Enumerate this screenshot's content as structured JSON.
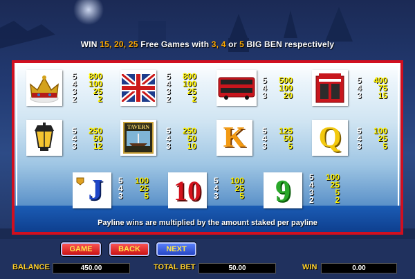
{
  "header": {
    "prefix": "WIN",
    "n1": "15,",
    "n2": "20,",
    "n3": "25",
    "mid": "Free Games with",
    "c1": "3,",
    "c2": "4",
    "or": "or",
    "c3": "5",
    "suffix_hl": "BIG BEN",
    "suffix": "respectively"
  },
  "symbols": [
    {
      "name": "crown",
      "icon": "crown-icon",
      "pays": [
        [
          "5",
          "800"
        ],
        [
          "4",
          "100"
        ],
        [
          "3",
          "25"
        ],
        [
          "2",
          "2"
        ]
      ]
    },
    {
      "name": "union-flag",
      "icon": "union-flag-icon",
      "pays": [
        [
          "5",
          "800"
        ],
        [
          "4",
          "100"
        ],
        [
          "3",
          "25"
        ],
        [
          "2",
          "2"
        ]
      ]
    },
    {
      "name": "bus",
      "icon": "double-decker-bus-icon",
      "pays": [
        [
          "5",
          "500"
        ],
        [
          "4",
          "100"
        ],
        [
          "3",
          "20"
        ]
      ]
    },
    {
      "name": "phone-booth",
      "icon": "telephone-box-icon",
      "pays": [
        [
          "5",
          "400"
        ],
        [
          "4",
          "75"
        ],
        [
          "3",
          "15"
        ]
      ]
    },
    {
      "name": "lamp",
      "icon": "street-lamp-icon",
      "pays": [
        [
          "5",
          "250"
        ],
        [
          "4",
          "50"
        ],
        [
          "3",
          "12"
        ]
      ]
    },
    {
      "name": "tavern",
      "icon": "tavern-sign-icon",
      "label": "TAVERN",
      "pays": [
        [
          "5",
          "250"
        ],
        [
          "4",
          "50"
        ],
        [
          "3",
          "10"
        ]
      ]
    },
    {
      "name": "king",
      "icon": "letter-k-icon",
      "label": "K",
      "pays": [
        [
          "5",
          "125"
        ],
        [
          "4",
          "50"
        ],
        [
          "3",
          "5"
        ]
      ]
    },
    {
      "name": "queen",
      "icon": "letter-q-icon",
      "label": "Q",
      "pays": [
        [
          "5",
          "100"
        ],
        [
          "4",
          "25"
        ],
        [
          "3",
          "5"
        ]
      ]
    },
    {
      "name": "jack",
      "icon": "letter-j-icon",
      "label": "J",
      "pays": [
        [
          "5",
          "100"
        ],
        [
          "4",
          "25"
        ],
        [
          "3",
          "5"
        ]
      ]
    },
    {
      "name": "ten",
      "icon": "number-10-icon",
      "label": "10",
      "pays": [
        [
          "5",
          "100"
        ],
        [
          "4",
          "25"
        ],
        [
          "3",
          "5"
        ]
      ]
    },
    {
      "name": "nine",
      "icon": "number-9-icon",
      "label": "9",
      "pays": [
        [
          "5",
          "100"
        ],
        [
          "4",
          "25"
        ],
        [
          "3",
          "5"
        ],
        [
          "2",
          "2"
        ]
      ]
    }
  ],
  "footnote": "Payline wins are multiplied by the amount staked per payline",
  "buttons": {
    "game": "GAME",
    "back": "BACK",
    "next": "NEXT"
  },
  "status": {
    "balance_label": "BALANCE",
    "balance": "450.00",
    "bet_label": "TOTAL BET",
    "bet": "50.00",
    "win_label": "WIN",
    "win": "0.00"
  },
  "colors": {
    "accent_yellow": "#fff200",
    "header_orange": "#ffaa00",
    "frame_red": "#d10f1f"
  }
}
